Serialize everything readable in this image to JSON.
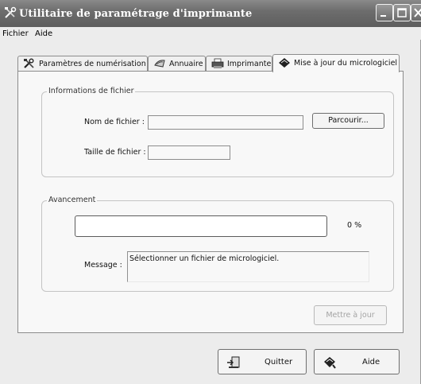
{
  "window": {
    "title": "Utilitaire de paramétrage d'imprimante",
    "icon": "printer-tools-icon"
  },
  "menubar": {
    "items": [
      {
        "label": "Fichier"
      },
      {
        "label": "Aide"
      }
    ]
  },
  "tabs": [
    {
      "label": "Paramètres de numérisation",
      "icon": "scanner-settings-icon",
      "active": false
    },
    {
      "label": "Annuaire",
      "icon": "address-book-icon",
      "active": false
    },
    {
      "label": "Imprimante",
      "icon": "printer-icon",
      "active": false
    },
    {
      "label": "Mise à jour du micrologiciel",
      "icon": "firmware-chip-icon",
      "active": true
    }
  ],
  "file_info": {
    "legend": "Informations de fichier",
    "filename_label": "Nom de fichier :",
    "filename_value": "",
    "browse_button": "Parcourir...",
    "filesize_label": "Taille de fichier :",
    "filesize_value": ""
  },
  "progress": {
    "legend": "Avancement",
    "percent": 0,
    "percent_text": "0 %",
    "message_label": "Message :",
    "message_text": "Sélectionner un fichier de micrologiciel.",
    "update_button": "Mettre à jour",
    "fill_color": "#5a7bbf"
  },
  "footer": {
    "quit_button": "Quitter",
    "help_button": "Aide"
  }
}
